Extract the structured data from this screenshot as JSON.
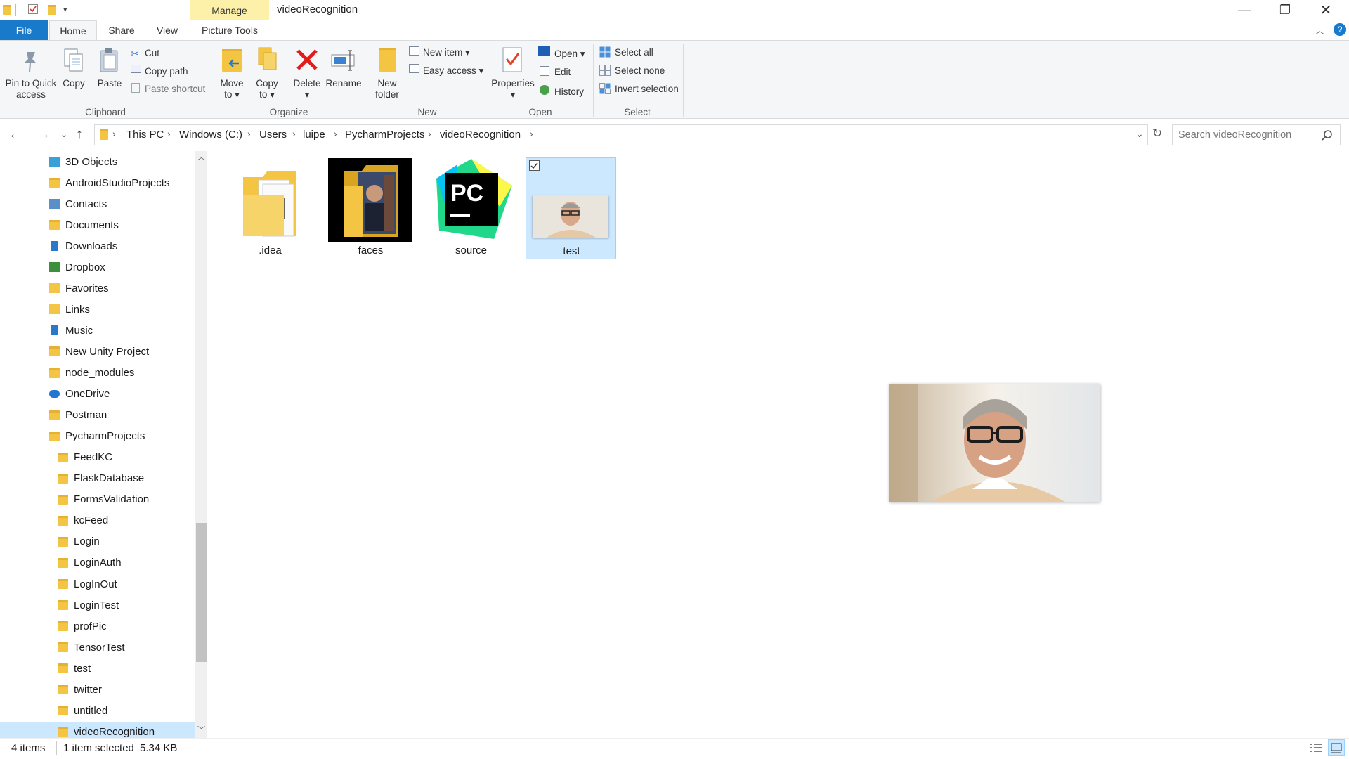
{
  "window": {
    "title": "videoRecognition",
    "contextual_tab_group": "Manage",
    "minimize": "—",
    "restore": "❐",
    "close": "✕"
  },
  "tabs": [
    {
      "label": "File"
    },
    {
      "label": "Home"
    },
    {
      "label": "Share"
    },
    {
      "label": "View"
    },
    {
      "label": "Picture Tools"
    }
  ],
  "ribbon": {
    "clipboard": {
      "group_label": "Clipboard",
      "pin_label_1": "Pin to Quick",
      "pin_label_2": "access",
      "copy": "Copy",
      "paste": "Paste",
      "cut": "Cut",
      "copy_path": "Copy path",
      "paste_shortcut": "Paste shortcut"
    },
    "organize": {
      "group_label": "Organize",
      "move_to_1": "Move",
      "move_to_2": "to",
      "copy_to_1": "Copy",
      "copy_to_2": "to",
      "delete": "Delete",
      "rename": "Rename"
    },
    "new": {
      "group_label": "New",
      "new_folder_1": "New",
      "new_folder_2": "folder",
      "new_item": "New item",
      "easy_access": "Easy access"
    },
    "open": {
      "group_label": "Open",
      "properties": "Properties",
      "open": "Open",
      "edit": "Edit",
      "history": "History"
    },
    "select": {
      "group_label": "Select",
      "select_all": "Select all",
      "select_none": "Select none",
      "invert_selection": "Invert selection"
    }
  },
  "address": {
    "breadcrumbs": [
      "This PC",
      "Windows (C:)",
      "Users",
      "luipe",
      "PycharmProjects",
      "videoRecognition"
    ],
    "search_placeholder": "Search videoRecognition"
  },
  "sidebar": {
    "items": [
      {
        "label": "3D Objects",
        "icon": "3d-objects-icon",
        "indent": 0
      },
      {
        "label": "AndroidStudioProjects",
        "icon": "folder-icon",
        "indent": 0
      },
      {
        "label": "Contacts",
        "icon": "contacts-icon",
        "indent": 0
      },
      {
        "label": "Documents",
        "icon": "folder-icon",
        "indent": 0
      },
      {
        "label": "Downloads",
        "icon": "download-icon",
        "indent": 0
      },
      {
        "label": "Dropbox",
        "icon": "dropbox-icon",
        "indent": 0
      },
      {
        "label": "Favorites",
        "icon": "favorites-icon",
        "indent": 0
      },
      {
        "label": "Links",
        "icon": "links-icon",
        "indent": 0
      },
      {
        "label": "Music",
        "icon": "music-icon",
        "indent": 0
      },
      {
        "label": "New Unity Project",
        "icon": "folder-icon",
        "indent": 0
      },
      {
        "label": "node_modules",
        "icon": "folder-icon",
        "indent": 0
      },
      {
        "label": "OneDrive",
        "icon": "onedrive-icon",
        "indent": 0
      },
      {
        "label": "Postman",
        "icon": "folder-icon",
        "indent": 0
      },
      {
        "label": "PycharmProjects",
        "icon": "folder-icon",
        "indent": 0
      },
      {
        "label": "FeedKC",
        "icon": "folder-icon",
        "indent": 1
      },
      {
        "label": "FlaskDatabase",
        "icon": "folder-icon",
        "indent": 1
      },
      {
        "label": "FormsValidation",
        "icon": "folder-icon",
        "indent": 1
      },
      {
        "label": "kcFeed",
        "icon": "folder-icon",
        "indent": 1
      },
      {
        "label": "Login",
        "icon": "folder-icon",
        "indent": 1
      },
      {
        "label": "LoginAuth",
        "icon": "folder-icon",
        "indent": 1
      },
      {
        "label": "LogInOut",
        "icon": "folder-icon",
        "indent": 1
      },
      {
        "label": "LoginTest",
        "icon": "folder-icon",
        "indent": 1
      },
      {
        "label": "profPic",
        "icon": "folder-icon",
        "indent": 1
      },
      {
        "label": "TensorTest",
        "icon": "folder-icon",
        "indent": 1
      },
      {
        "label": "test",
        "icon": "folder-icon",
        "indent": 1
      },
      {
        "label": "twitter",
        "icon": "folder-icon",
        "indent": 1
      },
      {
        "label": "untitled",
        "icon": "folder-icon",
        "indent": 1
      },
      {
        "label": "videoRecognition",
        "icon": "folder-icon",
        "indent": 1,
        "selected": true
      }
    ]
  },
  "files": [
    {
      "name": ".idea",
      "type": "folder"
    },
    {
      "name": "faces",
      "type": "folder"
    },
    {
      "name": "source",
      "type": "pycharm-file"
    },
    {
      "name": "test",
      "type": "image",
      "selected": true
    }
  ],
  "status": {
    "item_count": "4 items",
    "selection": "1 item selected",
    "size": "5.34 KB"
  }
}
